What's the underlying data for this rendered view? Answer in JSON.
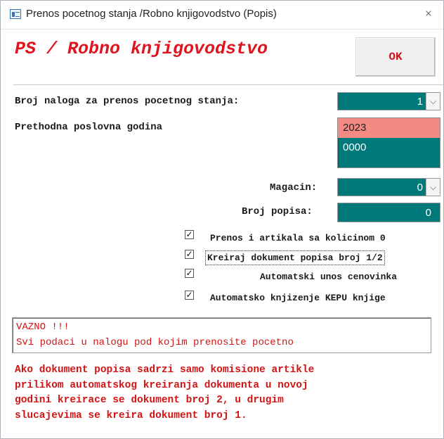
{
  "window": {
    "title": "Prenos pocetnog stanja /Robno knjigovodstvo  (Popis)",
    "close_glyph": "⨯",
    "app_icon": "form-icon"
  },
  "header": {
    "title": "PS / Robno knjigovodstvo",
    "ok_label": "OK"
  },
  "form": {
    "broj_naloga_label": "Broj naloga za prenos pocetnog stanja:",
    "broj_naloga_value": "1",
    "prethodna_label": "Prethodna poslovna godina",
    "godine": [
      "2023",
      "0000"
    ],
    "godina_selected": "2023",
    "magacin_label": "Magacin:",
    "magacin_value": "0",
    "broj_popisa_label": "Broj popisa:",
    "broj_popisa_value": "0",
    "dropdown_glyph": "⌵"
  },
  "checkboxes": [
    {
      "label": "Prenos i artikala sa kolicinom 0",
      "checked": true
    },
    {
      "label": "Kreiraj dokument popisa broj 1/2",
      "checked": true
    },
    {
      "label": "Automatski unos cenovinka",
      "checked": true
    },
    {
      "label": "Automatsko knjizenje KEPU knjige",
      "checked": true
    }
  ],
  "check_glyph": "✓",
  "warning": {
    "line1": "VAZNO !!!",
    "line2": "Svi podaci u nalogu pod kojim prenosite pocetno"
  },
  "note": [
    "Ako dokument popisa sadrzi samo komisione artikle",
    "prilikom automatskog kreiranja dokumenta u novoj",
    "godini kreirace se dokument broj 2, u drugim",
    "slucajevima se kreira dokument broj 1."
  ],
  "colors": {
    "accent_red": "#e0141e",
    "field_teal": "#00797a",
    "selected_item": "#f48a84"
  }
}
